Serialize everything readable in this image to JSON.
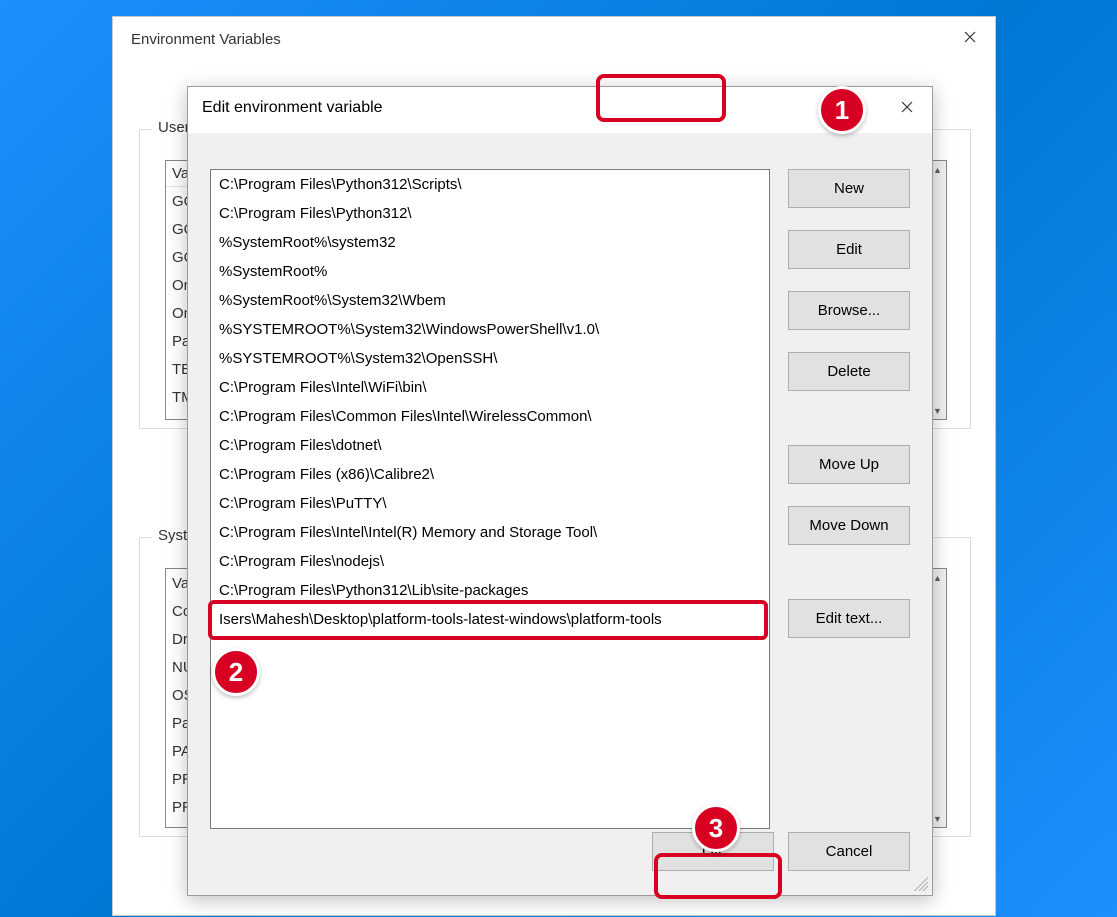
{
  "parent_dialog": {
    "title": "Environment Variables",
    "user_group_label": "User",
    "system_group_label": "Syste",
    "user_vars_header": "Va",
    "user_vars_rows": [
      "GO",
      "GO",
      "GO",
      "On",
      "On",
      "Pat",
      "TEI",
      "TM"
    ],
    "system_vars_rows": [
      "Va",
      "Co",
      "Dri",
      "NU",
      "OS",
      "Pat",
      "PA",
      "PR",
      "PR"
    ]
  },
  "edit_dialog": {
    "title": "Edit environment variable",
    "paths": [
      "C:\\Program Files\\Python312\\Scripts\\",
      "C:\\Program Files\\Python312\\",
      "%SystemRoot%\\system32",
      "%SystemRoot%",
      "%SystemRoot%\\System32\\Wbem",
      "%SYSTEMROOT%\\System32\\WindowsPowerShell\\v1.0\\",
      "%SYSTEMROOT%\\System32\\OpenSSH\\",
      "C:\\Program Files\\Intel\\WiFi\\bin\\",
      "C:\\Program Files\\Common Files\\Intel\\WirelessCommon\\",
      "C:\\Program Files\\dotnet\\",
      "C:\\Program Files (x86)\\Calibre2\\",
      "C:\\Program Files\\PuTTY\\",
      "C:\\Program Files\\Intel\\Intel(R) Memory and Storage Tool\\",
      "C:\\Program Files\\nodejs\\",
      "C:\\Program Files\\Python312\\Lib\\site-packages",
      "Isers\\Mahesh\\Desktop\\platform-tools-latest-windows\\platform-tools"
    ],
    "buttons": {
      "new": "New",
      "edit": "Edit",
      "browse": "Browse...",
      "delete": "Delete",
      "move_up": "Move Up",
      "move_down": "Move Down",
      "edit_text": "Edit text...",
      "ok": "OK",
      "cancel": "Cancel"
    }
  },
  "annotations": {
    "step1": "1",
    "step2": "2",
    "step3": "3"
  }
}
